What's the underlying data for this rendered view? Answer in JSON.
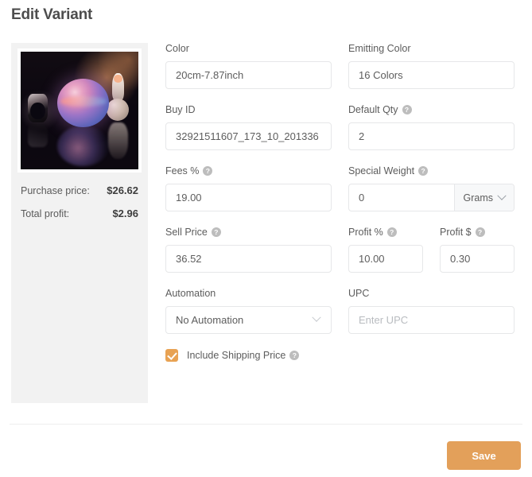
{
  "header": {
    "title": "Edit Variant"
  },
  "left_panel": {
    "thumbnail_alt": "product-photo-galaxy-moon-lamp",
    "stats": [
      {
        "label": "Purchase price:",
        "value": "$26.62"
      },
      {
        "label": "Total profit:",
        "value": "$2.96"
      }
    ]
  },
  "form": {
    "color": {
      "label": "Color",
      "value": "20cm-7.87inch"
    },
    "emitting_color": {
      "label": "Emitting Color",
      "value": "16 Colors"
    },
    "buy_id": {
      "label": "Buy ID",
      "value": "32921511607_173_10_201336"
    },
    "default_qty": {
      "label": "Default Qty",
      "value": "2",
      "help": "?"
    },
    "fees_pct": {
      "label": "Fees %",
      "value": "19.00",
      "help": "?"
    },
    "special_weight": {
      "label": "Special Weight",
      "value": "0",
      "help": "?",
      "unit": "Grams"
    },
    "sell_price": {
      "label": "Sell Price",
      "value": "36.52",
      "help": "?"
    },
    "profit_pct": {
      "label": "Profit %",
      "value": "10.00",
      "help": "?"
    },
    "profit_dollar": {
      "label": "Profit $",
      "value": "0.30",
      "help": "?"
    },
    "automation": {
      "label": "Automation",
      "value": "No Automation"
    },
    "upc": {
      "label": "UPC",
      "value": "",
      "placeholder": "Enter UPC"
    },
    "include_shipping": {
      "label": "Include Shipping Price",
      "checked": true,
      "help": "?"
    }
  },
  "footer": {
    "save_label": "Save"
  },
  "colors": {
    "accent_orange": "#e3a05a",
    "panel_gray": "#f2f2f2",
    "border_gray": "#e6e7e9",
    "text_gray": "#5c5c5c"
  }
}
